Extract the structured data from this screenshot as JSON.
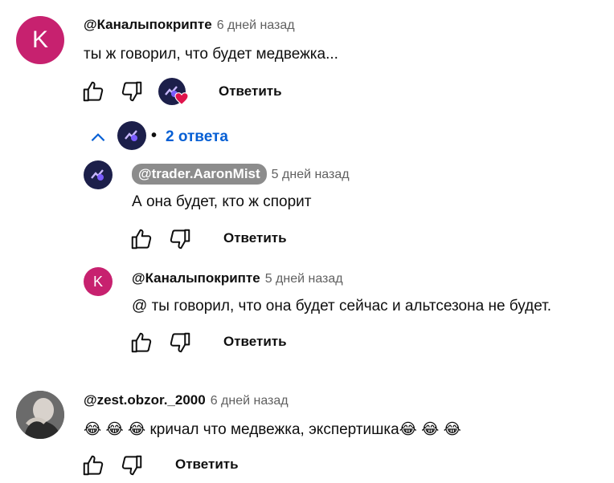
{
  "comments": [
    {
      "author": "@Каналыпокрипте",
      "time": "6 дней назад",
      "text": "ты ж говорил, что будет медвежка...",
      "avatar_letter": "K",
      "reply_label": "Ответить"
    },
    {
      "author": "@zest.obzor._2000",
      "time": "6 дней назад",
      "text": "😂 😂 😂  кричал что медвежка,  экспертишка😂 😂 😂",
      "reply_label": "Ответить"
    }
  ],
  "replies_toggle": {
    "label": "2 ответа",
    "bullet": "•"
  },
  "replies": [
    {
      "author": "@trader.AaronMist",
      "time": "5 дней назад",
      "text": "А она будет, кто ж спорит",
      "reply_label": "Ответить"
    },
    {
      "author": "@Каналыпокрипте",
      "time": "5 дней назад",
      "text": "@ ты говорил, что она будет сейчас и альтсезона не будет.",
      "avatar_letter": "K",
      "reply_label": "Ответить"
    }
  ],
  "colors": {
    "avatar_k": "#c7216f",
    "link_blue": "#065fd4",
    "heart": "#e0144c",
    "creator_pill": "#8c8c8c"
  }
}
